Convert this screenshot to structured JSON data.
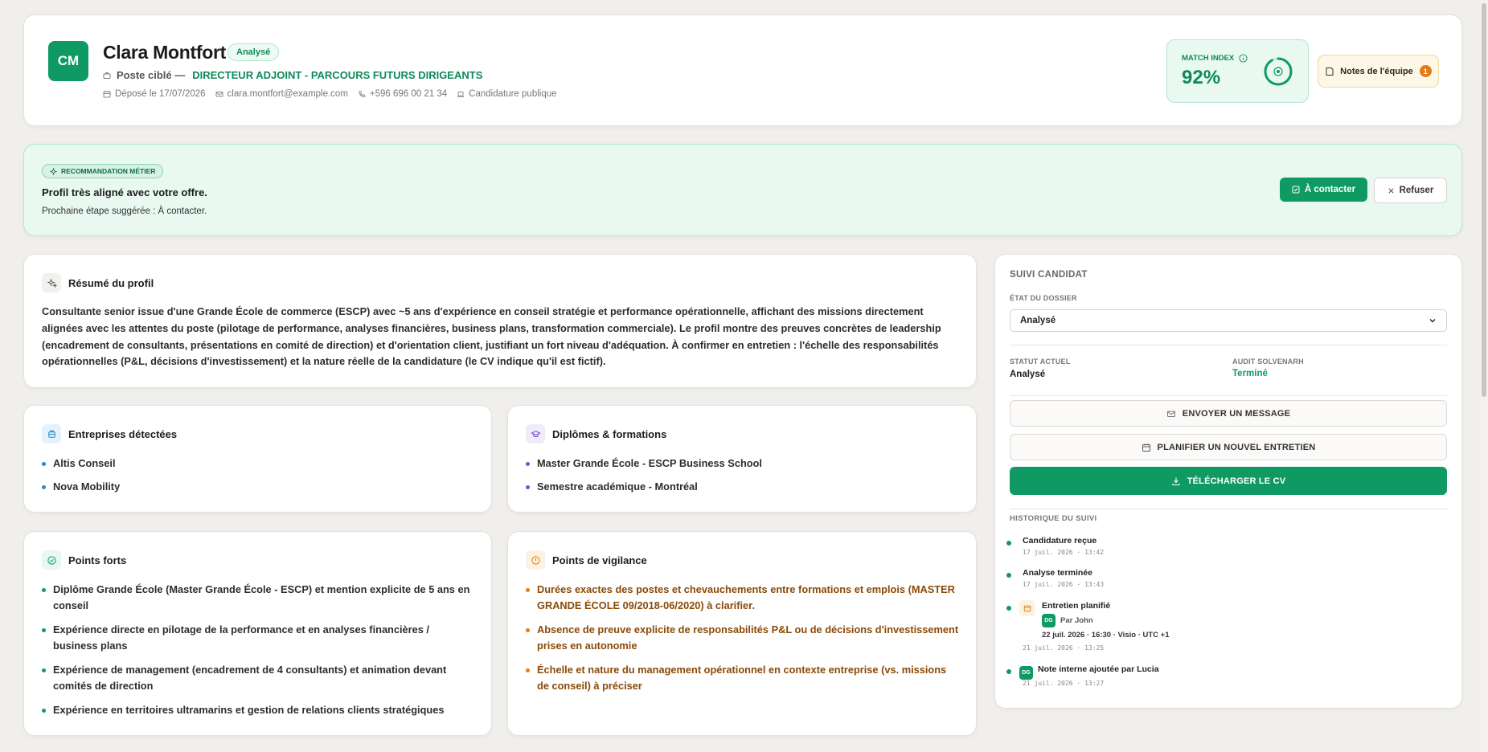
{
  "candidate": {
    "initials": "CM",
    "name": "Clara Montfort",
    "status": "Analysé",
    "target_label": "Poste ciblé —",
    "target_value": "DIRECTEUR ADJOINT - PARCOURS FUTURS DIRIGEANTS",
    "submitted": "Déposé le 17/07/2026",
    "email": "clara.montfort@example.com",
    "phone": "+596 696 00 21 34",
    "source": "Candidature publique"
  },
  "match": {
    "label": "MATCH INDEX",
    "value": "92%",
    "percent": 92
  },
  "notes": {
    "label": "Notes de l'équipe",
    "count": "1"
  },
  "recommendation": {
    "badge": "RECOMMANDATION MÉTIER",
    "title": "Profil très aligné avec votre offre.",
    "subtitle": "Prochaine étape suggérée : À contacter.",
    "contact_label": "À contacter",
    "refuse_label": "Refuser"
  },
  "summary": {
    "title": "Résumé du profil",
    "text": "Consultante senior issue d'une Grande École de commerce (ESCP) avec ~5 ans d'expérience en conseil stratégie et performance opérationnelle, affichant des missions directement alignées avec les attentes du poste (pilotage de performance, analyses financières, business plans, transformation commerciale). Le profil montre des preuves concrètes de leadership (encadrement de consultants, présentations en comité de direction) et d'orientation client, justifiant un fort niveau d'adéquation. À confirmer en entretien : l'échelle des responsabilités opérationnelles (P&L, décisions d'investissement) et la nature réelle de la candidature (le CV indique qu'il est fictif)."
  },
  "companies": {
    "title": "Entreprises détectées",
    "items": [
      "Altis Conseil",
      "Nova Mobility"
    ]
  },
  "degrees": {
    "title": "Diplômes & formations",
    "items": [
      "Master Grande École - ESCP Business School",
      "Semestre académique - Montréal"
    ]
  },
  "strengths": {
    "title": "Points forts",
    "items": [
      "Diplôme Grande École (Master Grande École - ESCP) et mention explicite de 5 ans en conseil",
      "Expérience directe en pilotage de la performance et en analyses financières / business plans",
      "Expérience de management (encadrement de 4 consultants) et animation devant comités de direction",
      "Expérience en territoires ultramarins et gestion de relations clients stratégiques"
    ]
  },
  "watch": {
    "title": "Points de vigilance",
    "items": [
      "Durées exactes des postes et chevauchements entre formations et emplois (MASTER GRANDE ÉCOLE 09/2018-06/2020) à clarifier.",
      "Absence de preuve explicite de responsabilités P&L ou de décisions d'investissement prises en autonomie",
      "Échelle et nature du management opérationnel en contexte entreprise (vs. missions de conseil) à préciser"
    ]
  },
  "sidebar": {
    "title": "SUIVI CANDIDAT",
    "state_label": "ÉTAT DU DOSSIER",
    "state_value": "Analysé",
    "status_label": "STATUT ACTUEL",
    "status_value": "Analysé",
    "audit_label": "AUDIT SOLVENARH",
    "audit_value": "Terminé",
    "send_message": "ENVOYER UN MESSAGE",
    "plan_interview": "PLANIFIER UN NOUVEL ENTRETIEN",
    "download_cv": "TÉLÉCHARGER LE CV",
    "history_title": "HISTORIQUE DU SUIVI",
    "history": [
      {
        "title": "Candidature reçue",
        "time": "17 juil. 2026 · 13:42"
      },
      {
        "title": "Analyse terminée",
        "time": "17 juil. 2026 · 13:43"
      },
      {
        "title": "Entretien planifié",
        "by": "Par John",
        "by_initials": "DG",
        "detail": "22 juil. 2026 · 16:30 · Visio · UTC +1",
        "time": "21 juil. 2026 · 13:25"
      },
      {
        "title": "Note interne ajoutée par Lucia",
        "by_initials": "DG",
        "time": "21 juil. 2026 · 13:27"
      }
    ]
  },
  "colors": {
    "brand": "#0f9a64",
    "warning": "#8a4a07",
    "accent_bg": "#e9f8f1"
  }
}
